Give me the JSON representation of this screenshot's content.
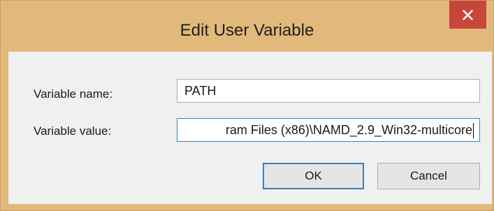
{
  "window": {
    "title": "Edit User Variable"
  },
  "form": {
    "name_label": "Variable name:",
    "name_value": "PATH",
    "value_label": "Variable value:",
    "value_value": "ram Files (x86)\\NAMD_2.9_Win32-multicore"
  },
  "buttons": {
    "ok_label": "OK",
    "cancel_label": "Cancel"
  },
  "colors": {
    "frame": "#e1b97a",
    "close": "#c7453b",
    "client": "#f0f0f0",
    "focus_border": "#3c7fb1"
  },
  "icons": {
    "close": "close-icon"
  }
}
